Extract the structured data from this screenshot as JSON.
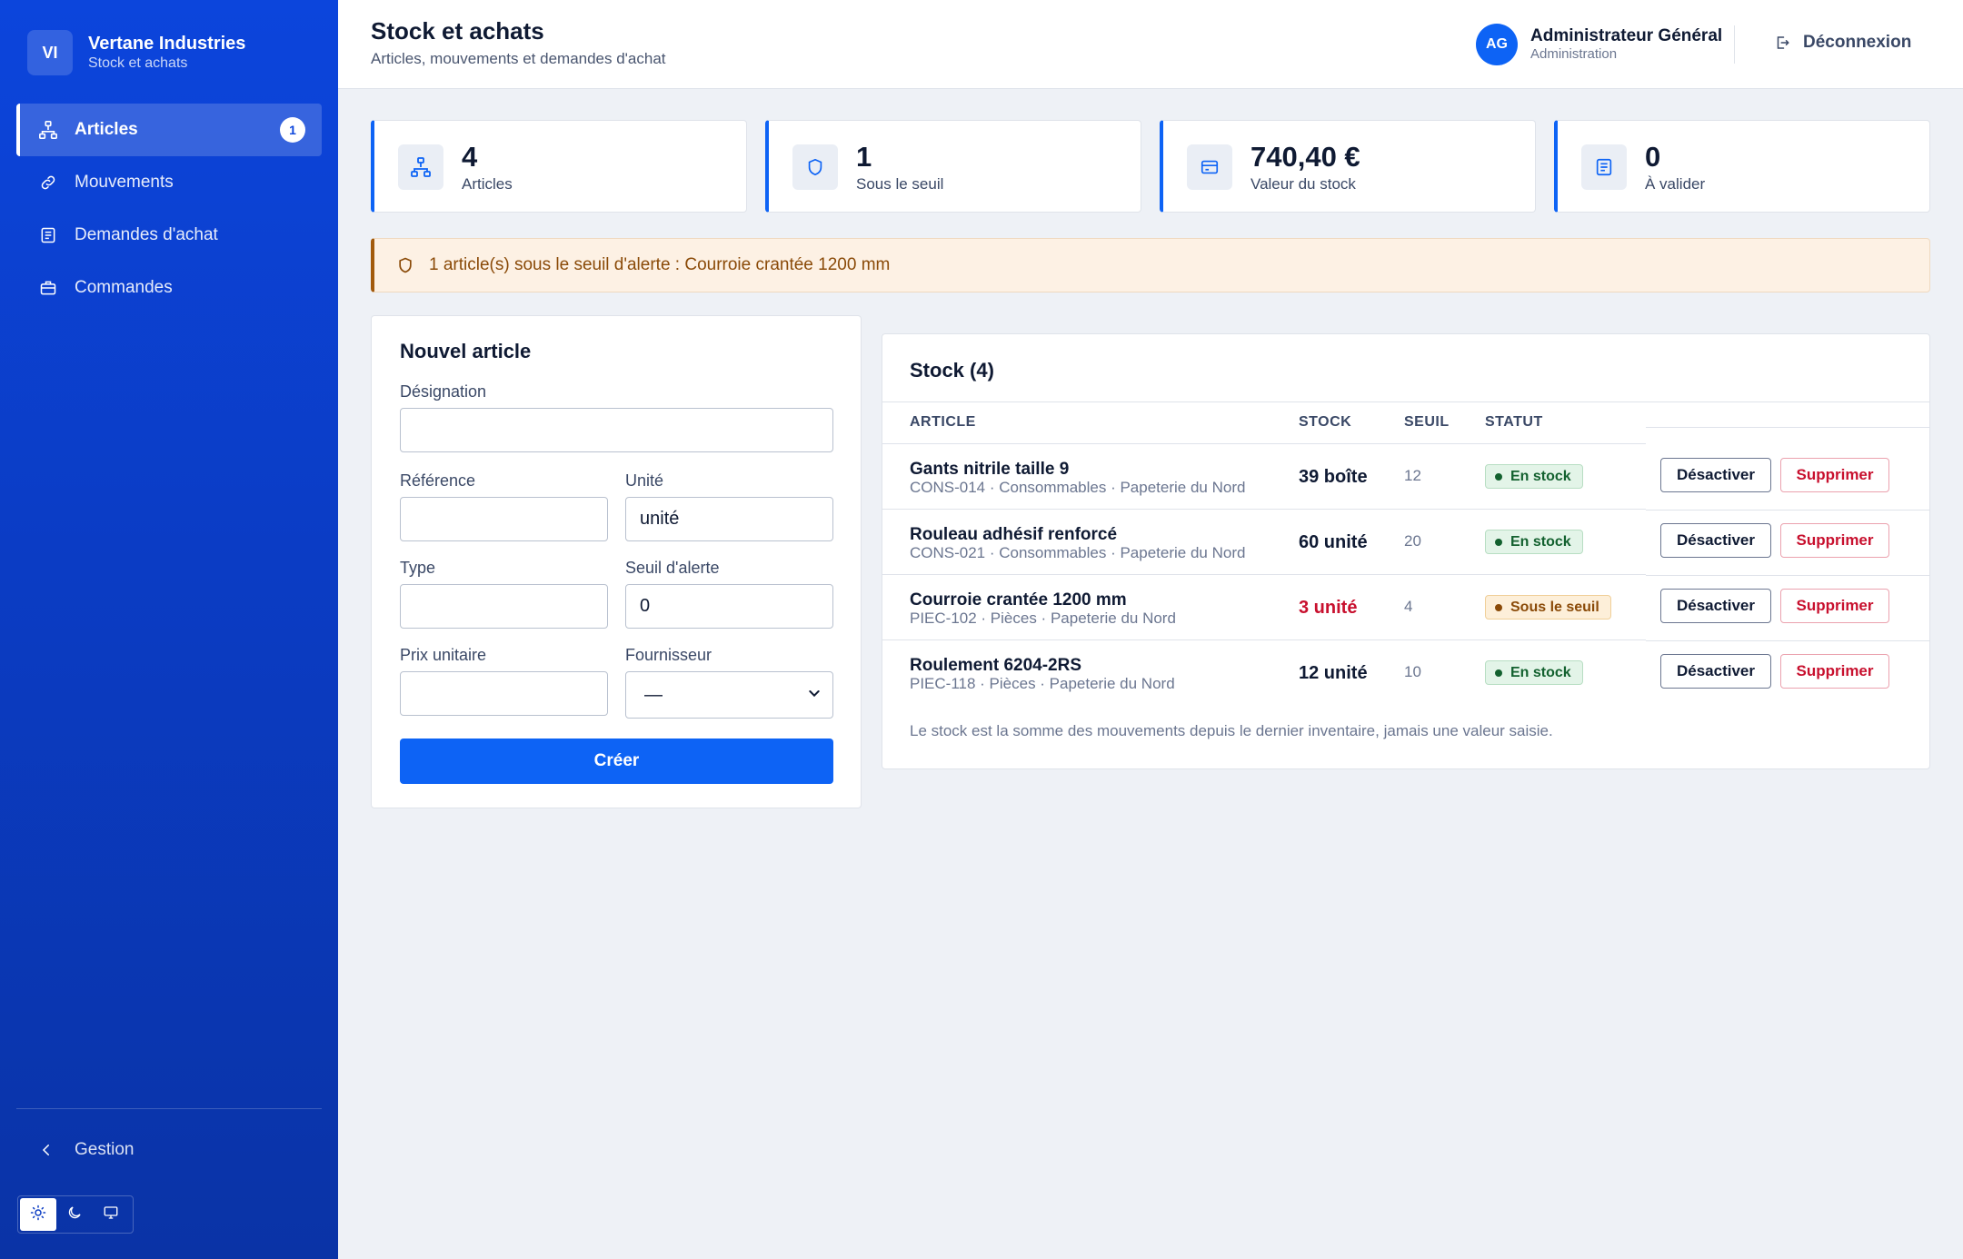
{
  "brand": {
    "initials": "VI",
    "name": "Vertane Industries",
    "subtitle": "Stock et achats"
  },
  "sidebar": {
    "items": [
      {
        "label": "Articles",
        "icon": "hierarchy-icon",
        "active": true,
        "badge": "1"
      },
      {
        "label": "Mouvements",
        "icon": "link-icon",
        "active": false
      },
      {
        "label": "Demandes d'achat",
        "icon": "document-icon",
        "active": false
      },
      {
        "label": "Commandes",
        "icon": "briefcase-icon",
        "active": false
      }
    ],
    "footer_label": "Gestion",
    "theme_modes": [
      "light",
      "dark",
      "system"
    ],
    "theme_active": "light"
  },
  "header": {
    "title": "Stock et achats",
    "subtitle": "Articles, mouvements et demandes d'achat",
    "user": {
      "initials": "AG",
      "name": "Administrateur Général",
      "role": "Administration"
    },
    "logout_label": "Déconnexion"
  },
  "stats": [
    {
      "value": "4",
      "label": "Articles",
      "icon": "hierarchy-icon"
    },
    {
      "value": "1",
      "label": "Sous le seuil",
      "icon": "shield-icon"
    },
    {
      "value": "740,40 €",
      "label": "Valeur du stock",
      "icon": "credit-card-icon"
    },
    {
      "value": "0",
      "label": "À valider",
      "icon": "document-icon"
    }
  ],
  "alert": {
    "text": "1 article(s) sous le seuil d'alerte : Courroie crantée 1200 mm"
  },
  "form": {
    "title": "Nouvel article",
    "designation_label": "Désignation",
    "designation_value": "",
    "reference_label": "Référence",
    "reference_value": "",
    "unite_label": "Unité",
    "unite_value": "unité",
    "type_label": "Type",
    "type_value": "",
    "seuil_label": "Seuil d'alerte",
    "seuil_value": "0",
    "prix_label": "Prix unitaire",
    "prix_value": "",
    "fournisseur_label": "Fournisseur",
    "fournisseur_value": "—",
    "submit_label": "Créer"
  },
  "stock": {
    "title": "Stock (4)",
    "columns": {
      "article": "ARTICLE",
      "stock": "STOCK",
      "seuil": "SEUIL",
      "statut": "STATUT"
    },
    "rows": [
      {
        "name": "Gants nitrile taille 9",
        "meta": "CONS-014 · Consommables · Papeterie du Nord",
        "stock": "39 boîte",
        "seuil": "12",
        "status": "En stock",
        "low": false
      },
      {
        "name": "Rouleau adhésif renforcé",
        "meta": "CONS-021 · Consommables · Papeterie du Nord",
        "stock": "60 unité",
        "seuil": "20",
        "status": "En stock",
        "low": false
      },
      {
        "name": "Courroie crantée 1200 mm",
        "meta": "PIEC-102 · Pièces · Papeterie du Nord",
        "stock": "3 unité",
        "seuil": "4",
        "status": "Sous le seuil",
        "low": true
      },
      {
        "name": "Roulement 6204-2RS",
        "meta": "PIEC-118 · Pièces · Papeterie du Nord",
        "stock": "12 unité",
        "seuil": "10",
        "status": "En stock",
        "low": false
      }
    ],
    "deactivate_label": "Désactiver",
    "delete_label": "Supprimer",
    "note": "Le stock est la somme des mouvements depuis le dernier inventaire, jamais une valeur saisie."
  },
  "colors": {
    "primary": "#0d63f5",
    "sidebar": "#0b3cc4",
    "danger": "#c8102e",
    "warning": "#8a4a08",
    "success": "#13612f"
  }
}
